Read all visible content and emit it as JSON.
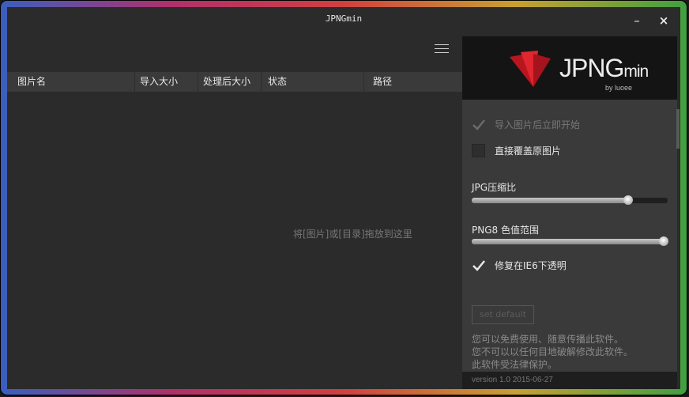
{
  "window": {
    "title": "JPNGmin",
    "minimize_label": "–",
    "close_label": "×"
  },
  "table": {
    "headers": [
      "图片名",
      "导入大小",
      "处理后大小",
      "状态",
      "路径"
    ],
    "drop_hint": "将[图片]或[目录]拖放到这里"
  },
  "logo": {
    "main": "JPNG",
    "suffix": "min",
    "by": "by luoee",
    "mark_color": "#c8202a"
  },
  "options": {
    "auto_start": {
      "label": "导入图片后立即开始",
      "checked": true,
      "disabled": true
    },
    "overwrite": {
      "label": "直接覆盖原图片",
      "checked": false
    },
    "ie6": {
      "label": "修复在IE6下透明",
      "checked": true
    }
  },
  "sliders": {
    "jpg": {
      "label": "JPG压缩比",
      "value": 0.8
    },
    "png": {
      "label": "PNG8 色值范围",
      "value": 0.98
    }
  },
  "default_button": "set default",
  "notice": [
    "您可以免费使用、随意传播此软件。",
    "您不可以以任何目地破解修改此软件。",
    "此软件受法律保护。"
  ],
  "footer": {
    "version": "version 1.0 2015-06-27"
  }
}
